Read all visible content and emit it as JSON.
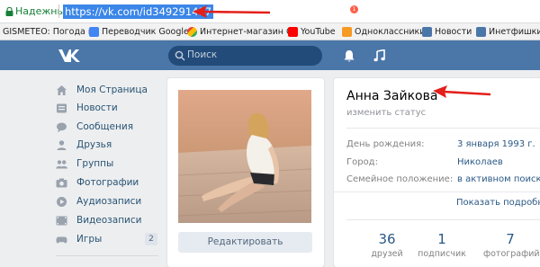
{
  "browser": {
    "secure_label": "Надежный",
    "url": "https://vk.com/id349291417"
  },
  "bookmarks": [
    {
      "label": "GISMETEO: Погода в",
      "icon": "gismeteo-icon"
    },
    {
      "label": "Переводчик Google",
      "icon": "google-translate-icon"
    },
    {
      "label": "Интернет-магазин C",
      "icon": "chrome-store-icon"
    },
    {
      "label": "YouTube",
      "icon": "youtube-icon"
    },
    {
      "label": "Одноклассники",
      "icon": "odnoklassniki-icon"
    },
    {
      "label": "Новости",
      "icon": "vk-icon"
    },
    {
      "label": "Инетфишки -",
      "icon": "vk-icon"
    }
  ],
  "header": {
    "search_placeholder": "Поиск",
    "notifications_count": "1"
  },
  "menu": [
    {
      "label": "Моя Страница",
      "icon": "home-icon"
    },
    {
      "label": "Новости",
      "icon": "news-icon"
    },
    {
      "label": "Сообщения",
      "icon": "messages-icon"
    },
    {
      "label": "Друзья",
      "icon": "friends-icon"
    },
    {
      "label": "Группы",
      "icon": "groups-icon"
    },
    {
      "label": "Фотографии",
      "icon": "camera-icon"
    },
    {
      "label": "Аудиозаписи",
      "icon": "audio-icon"
    },
    {
      "label": "Видеозаписи",
      "icon": "video-icon"
    },
    {
      "label": "Игры",
      "icon": "games-icon",
      "badge": "2"
    }
  ],
  "profile": {
    "edit_button": "Редактировать",
    "name": "Анна Зайкова",
    "status_placeholder": "изменить статус",
    "info": [
      {
        "label": "День рождения:",
        "value": "3 января 1993 г."
      },
      {
        "label": "Город:",
        "value": "Николаев"
      },
      {
        "label": "Семейное положение:",
        "value": "в активном поиске"
      }
    ],
    "show_more": "Показать подробну",
    "counters": [
      {
        "value": "36",
        "label": "друзей"
      },
      {
        "value": "1",
        "label": "подписчик"
      },
      {
        "value": "7",
        "label": "фотографий"
      }
    ]
  },
  "colors": {
    "vk_blue": "#4a76a8",
    "link": "#2a5885",
    "annotation_arrow": "#e3201b"
  }
}
